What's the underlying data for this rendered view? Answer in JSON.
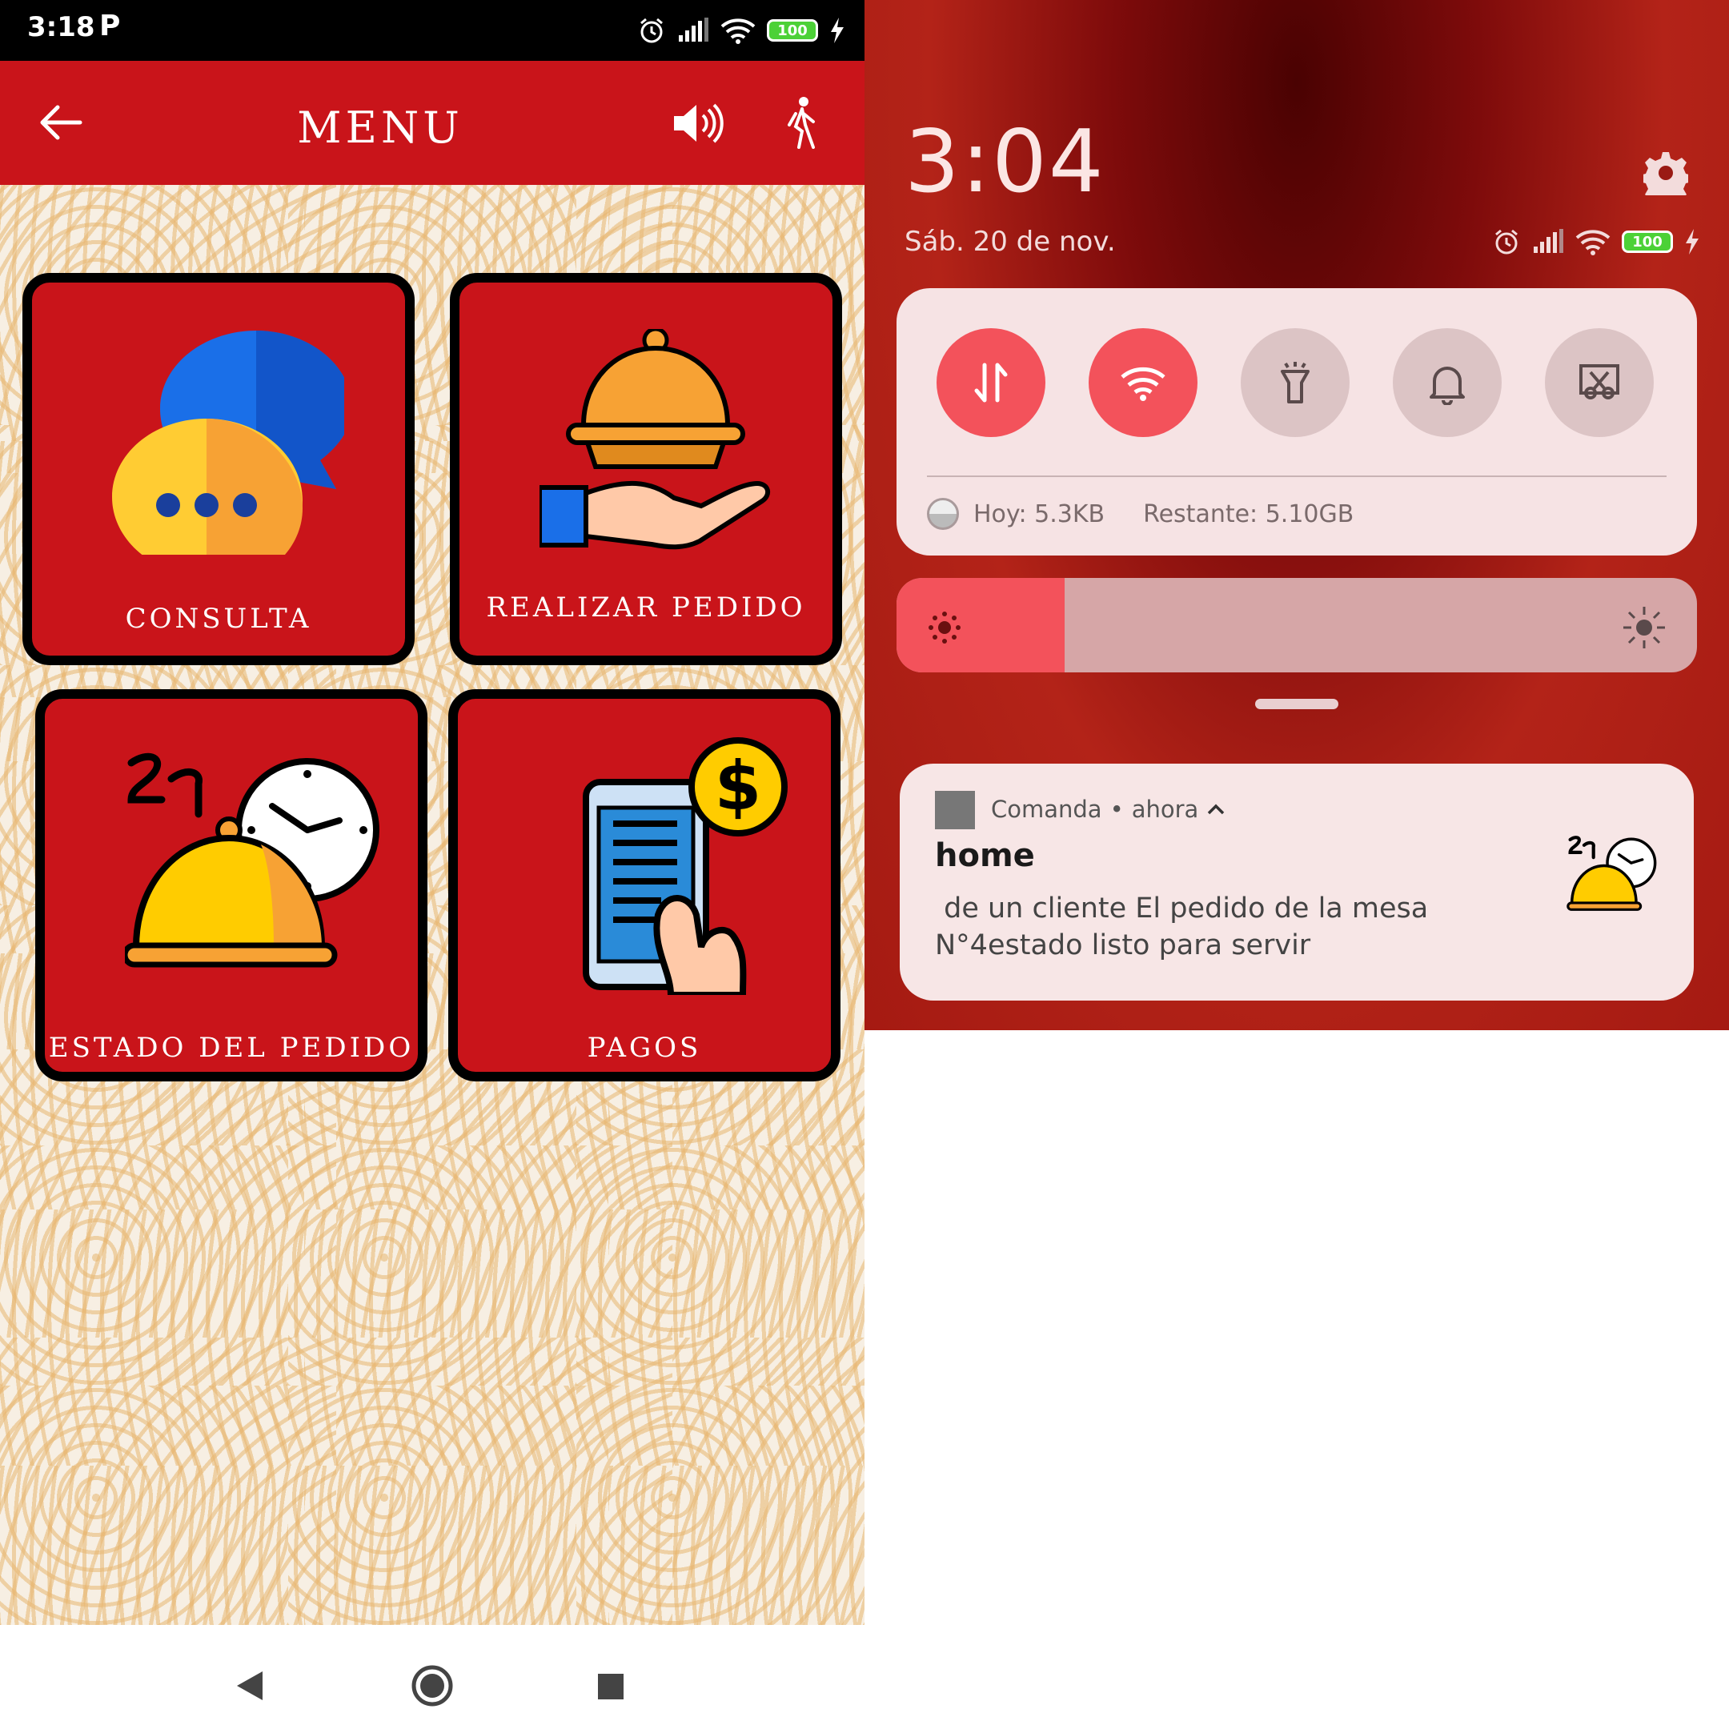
{
  "left_phone": {
    "status_bar": {
      "time": "3:18",
      "app_indicator": "P",
      "battery": "100"
    },
    "app_bar": {
      "title": "MENU",
      "icons": [
        "arrow-back-icon",
        "volume-icon",
        "walking-person-icon"
      ]
    },
    "tiles": [
      {
        "label": "CONSULTA",
        "icon": "chat-bubbles-icon"
      },
      {
        "label": "REALIZAR PEDIDO",
        "icon": "serving-cloche-hand-icon"
      },
      {
        "label": "ESTADO DEL PEDIDO",
        "icon": "cloche-clock-icon"
      },
      {
        "label": "PAGOS",
        "icon": "phone-payment-icon"
      }
    ],
    "nav_bar": {
      "icons": [
        "back-triangle-icon",
        "home-circle-icon",
        "recents-square-icon"
      ]
    },
    "colors": {
      "brand_red": "#c9141a",
      "tile_border": "#000000",
      "pattern": "#e8b670"
    }
  },
  "right_phone": {
    "clock": "3:04",
    "date": "Sáb. 20 de nov.",
    "battery": "100",
    "quick_settings": {
      "toggles": [
        {
          "name": "mobile-data-icon",
          "state": "on"
        },
        {
          "name": "wifi-icon",
          "state": "on"
        },
        {
          "name": "flashlight-icon",
          "state": "off"
        },
        {
          "name": "bell-icon",
          "state": "off"
        },
        {
          "name": "screenshot-icon",
          "state": "off"
        }
      ],
      "data_today": "Hoy: 5.3KB",
      "data_remaining": "Restante: 5.10GB"
    },
    "brightness": {
      "level_percent": 21
    },
    "notification": {
      "app_name": "Comanda",
      "separator": "•",
      "time": "ahora",
      "title": "home",
      "body": " de un cliente El pedido de la mesa\nN°4estado listo para servir"
    },
    "colors": {
      "accent": "#f3525b",
      "panel": "#f6e3e4"
    }
  }
}
